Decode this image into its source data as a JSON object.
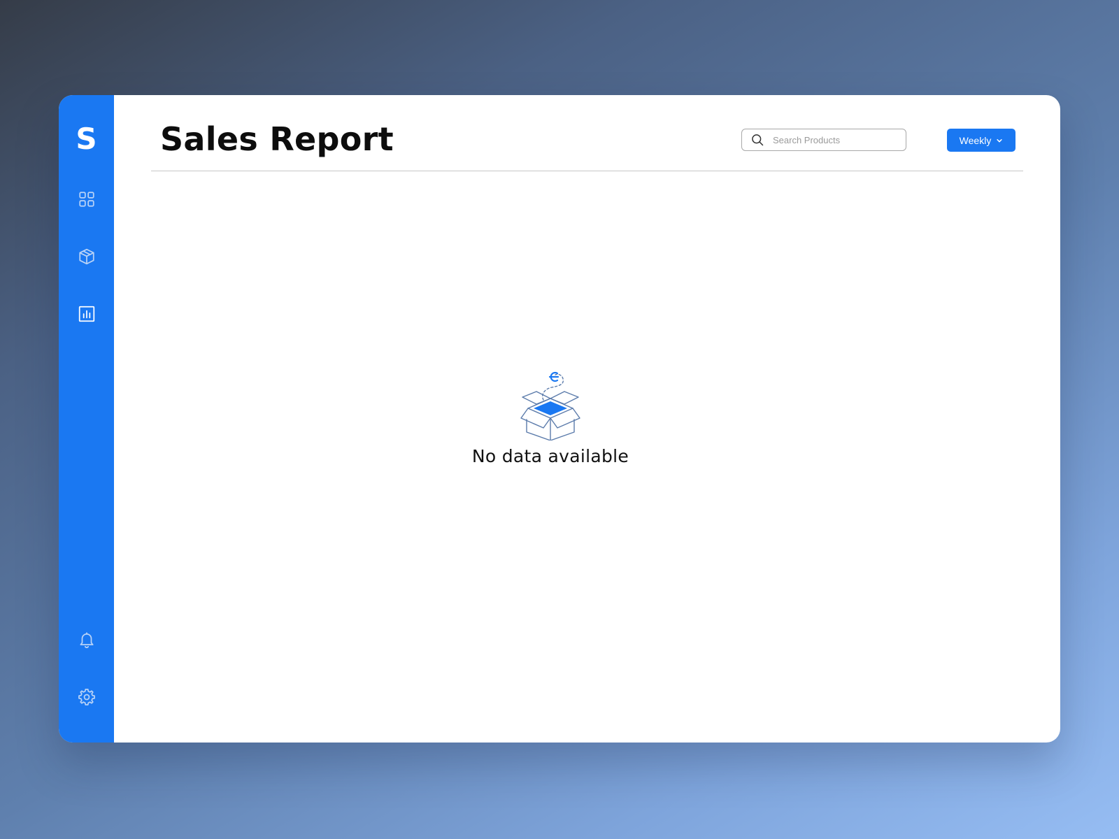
{
  "app": {
    "logo_letter": "S"
  },
  "sidebar": {
    "items": [
      {
        "icon": "grid-icon",
        "label": "Dashboard"
      },
      {
        "icon": "box-icon",
        "label": "Products"
      },
      {
        "icon": "bar-chart-icon",
        "label": "Reports",
        "active": true
      },
      {
        "icon": "bell-icon",
        "label": "Notifications"
      },
      {
        "icon": "gear-icon",
        "label": "Settings"
      }
    ]
  },
  "header": {
    "title": "Sales Report",
    "search_placeholder": "Search Products",
    "search_value": "",
    "period_selected": "Weekly"
  },
  "empty_state": {
    "message": "No data available",
    "illustration": "open-box-icon"
  },
  "colors": {
    "accent": "#1a78f2",
    "sidebar_icon": "#b9d3f7",
    "text": "#0d0d0d",
    "illustration_stroke": "#5b7bab"
  }
}
